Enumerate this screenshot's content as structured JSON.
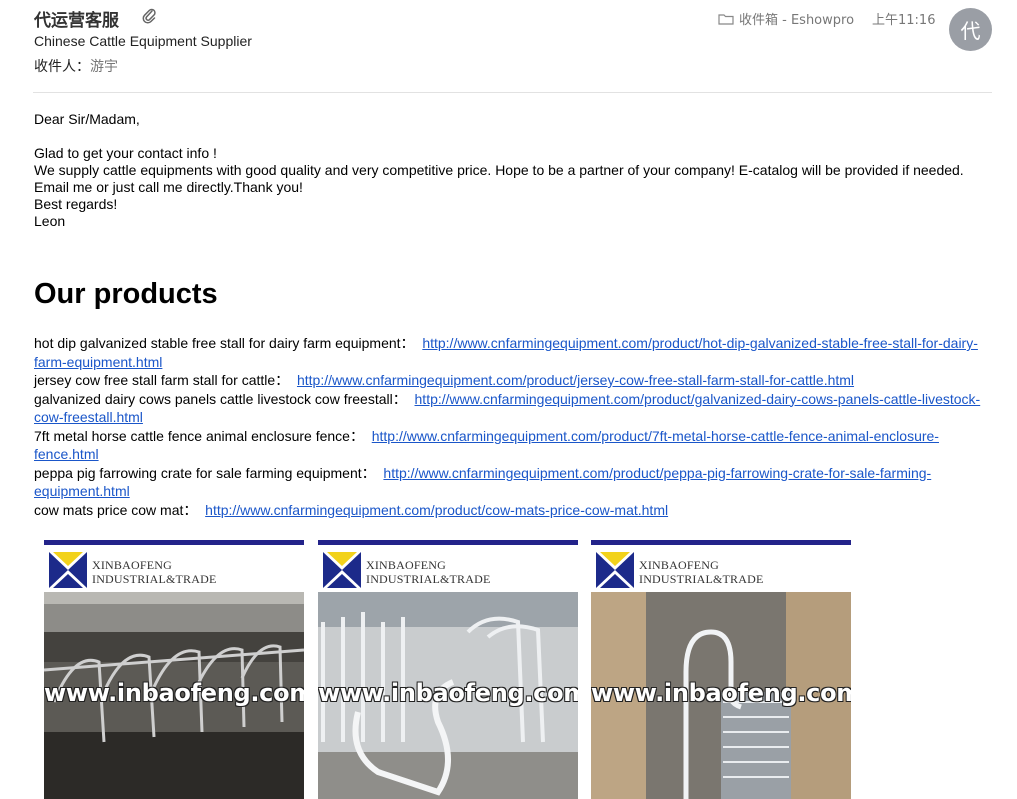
{
  "header": {
    "sender": "代运营客服",
    "subject": "Chinese Cattle Equipment Supplier",
    "recipient_label": "收件人：",
    "recipient_name": "游宇",
    "folder": "收件箱 - Eshowpro",
    "time": "上午11:16",
    "avatar_initial": "代"
  },
  "message": {
    "greeting": "Dear Sir/Madam,",
    "line1": "Glad to get your contact info !",
    "line2": "We supply cattle equipments with good quality and very competitive price. Hope to be a partner of your company! E-catalog will be provided if needed.",
    "line3": "Email me or just call me directly.Thank you!",
    "line4": "Best regards!",
    "signature": "Leon"
  },
  "products_heading": "Our products",
  "products": [
    {
      "name": "hot dip galvanized stable free stall for dairy farm equipment：",
      "url": "http://www.cnfarmingequipment.com/product/hot-dip-galvanized-stable-free-stall-for-dairy-farm-equipment.html"
    },
    {
      "name": "jersey cow free stall farm stall for cattle：",
      "url": "http://www.cnfarmingequipment.com/product/jersey-cow-free-stall-farm-stall-for-cattle.html"
    },
    {
      "name": "galvanized dairy cows panels cattle livestock cow freestall：",
      "url": "http://www.cnfarmingequipment.com/product/galvanized-dairy-cows-panels-cattle-livestock-cow-freestall.html"
    },
    {
      "name": "7ft metal horse cattle fence animal enclosure fence：",
      "url": "http://www.cnfarmingequipment.com/product/7ft-metal-horse-cattle-fence-animal-enclosure-fence.html"
    },
    {
      "name": "peppa pig farrowing crate for sale farming equipment：",
      "url": "http://www.cnfarmingequipment.com/product/peppa-pig-farrowing-crate-for-sale-farming-equipment.html"
    },
    {
      "name": "cow mats price cow mat：",
      "url": "http://www.cnfarmingequipment.com/product/cow-mats-price-cow-mat.html"
    }
  ],
  "image_cards": [
    {
      "brand_line1": "XINBAOFENG",
      "brand_line2": "INDUSTRIAL&TRADE",
      "watermark": "www.inbaofeng.com"
    },
    {
      "brand_line1": "XINBAOFENG",
      "brand_line2": "INDUSTRIAL&TRADE",
      "watermark": "www.inbaofeng.com"
    },
    {
      "brand_line1": "XINBAOFENG",
      "brand_line2": "INDUSTRIAL&TRADE",
      "watermark": "www.inbaofeng.com"
    }
  ],
  "icons": {
    "attachment": "paperclip-icon",
    "folder": "folder-icon"
  },
  "colors": {
    "link": "#1a56c9",
    "avatar_bg": "#9a9ea5",
    "brand_bar": "#23238a"
  }
}
